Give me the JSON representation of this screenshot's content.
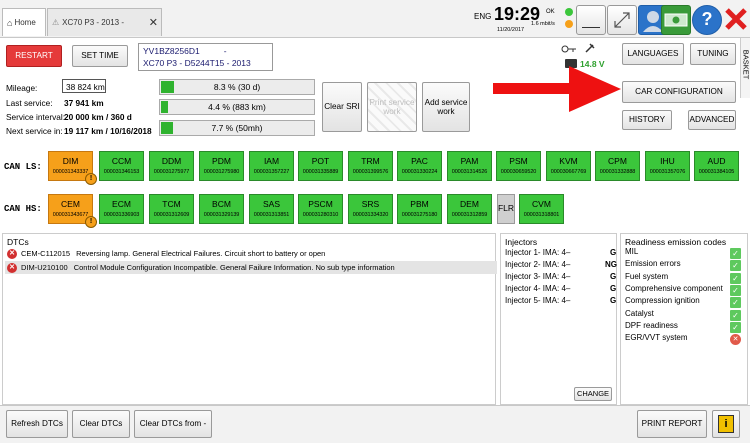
{
  "tabs": [
    {
      "label": "Home",
      "close": "✕"
    },
    {
      "label": "XC70 P3 - 2013 -",
      "close": "✕"
    }
  ],
  "status": {
    "lang": "ENG",
    "time": "19:29",
    "date": "11/20/2017",
    "speed": "1.6 mbit/s",
    "ok_label": "OK"
  },
  "toolbar": {
    "restart": "RESTART",
    "set_time": "SET TIME",
    "vin": "YV1BZ8256D1",
    "vin_suffix": "-",
    "model": "XC70 P3 - D5244T15 - 2013",
    "voltage": "14.8 V",
    "languages": "LANGUAGES",
    "tuning": "TUNING",
    "basket": "BASKET",
    "car_configuration": "CAR CONFIGURATION",
    "history": "HISTORY",
    "advanced": "ADVANCED"
  },
  "service": {
    "mileage_label": "Mileage:",
    "mileage_value": "38 824 km",
    "last_service_label": "Last service:",
    "last_service_value": "37 941 km",
    "interval_label": "Service interval:",
    "interval_value": "20 000 km / 360 d",
    "next_label": "Next service in:",
    "next_value": "19 117 km / 10/16/2018",
    "bars": [
      {
        "text": "8.3 % (30 d)",
        "fraction": 0.083
      },
      {
        "text": "4.4 % (883 km)",
        "fraction": 0.044
      },
      {
        "text": "7.7 % (50mh)",
        "fraction": 0.077
      }
    ],
    "clear_sri": "Clear SRI",
    "print_service": "Print service work",
    "add_service": "Add service work"
  },
  "can_ls": {
    "label": "CAN LS:",
    "ecus": [
      {
        "name": "DIM",
        "serial": "000031343337",
        "status": "warn"
      },
      {
        "name": "CCM",
        "serial": "000031346153",
        "status": "ok"
      },
      {
        "name": "DDM",
        "serial": "000031275977",
        "status": "ok"
      },
      {
        "name": "PDM",
        "serial": "000031275980",
        "status": "ok"
      },
      {
        "name": "IAM",
        "serial": "000031357227",
        "status": "ok"
      },
      {
        "name": "POT",
        "serial": "000031335889",
        "status": "ok"
      },
      {
        "name": "TRM",
        "serial": "000031399576",
        "status": "ok"
      },
      {
        "name": "PAC",
        "serial": "000031330224",
        "status": "ok"
      },
      {
        "name": "PAM",
        "serial": "000031314526",
        "status": "ok"
      },
      {
        "name": "PSM",
        "serial": "000030659520",
        "status": "ok"
      },
      {
        "name": "KVM",
        "serial": "000030667769",
        "status": "ok"
      },
      {
        "name": "CPM",
        "serial": "000031332888",
        "status": "ok"
      },
      {
        "name": "IHU",
        "serial": "000031357076",
        "status": "ok"
      },
      {
        "name": "AUD",
        "serial": "000031384105",
        "status": "ok"
      }
    ]
  },
  "can_hs": {
    "label": "CAN HS:",
    "ecus": [
      {
        "name": "CEM",
        "serial": "000031343677",
        "status": "warn"
      },
      {
        "name": "ECM",
        "serial": "000031336903",
        "status": "ok"
      },
      {
        "name": "TCM",
        "serial": "000031312609",
        "status": "ok"
      },
      {
        "name": "BCM",
        "serial": "000031329139",
        "status": "ok"
      },
      {
        "name": "SAS",
        "serial": "000031313851",
        "status": "ok"
      },
      {
        "name": "PSCM",
        "serial": "000031280310",
        "status": "ok"
      },
      {
        "name": "SRS",
        "serial": "000031334320",
        "status": "ok"
      },
      {
        "name": "PBM",
        "serial": "000031275180",
        "status": "ok"
      },
      {
        "name": "DEM",
        "serial": "000031312859",
        "status": "ok"
      },
      {
        "name": "FLR",
        "serial": "",
        "status": "gray"
      },
      {
        "name": "CVM",
        "serial": "000031318801",
        "status": "ok"
      }
    ]
  },
  "dtcs": {
    "title": "DTCs",
    "rows": [
      {
        "code": "CEM-C112015",
        "text": "Reversing lamp.  General Electrical Failures.  Circuit short to battery or open"
      },
      {
        "code": "DIM-U210100",
        "text": "Control Module Configuration Incompatible.  General Failure Information.  No sub type information"
      }
    ]
  },
  "injectors": {
    "title": "Injectors",
    "rows": [
      "Injector 1- IMA: 4–",
      "Injector 2- IMA: 4–",
      "Injector 3- IMA: 4–",
      "Injector 4- IMA: 4–",
      "Injector 5- IMA: 4–"
    ],
    "suffixes": [
      "G",
      "NG",
      "G",
      "G",
      "G"
    ],
    "change": "CHANGE"
  },
  "readiness": {
    "title": "Readiness emission codes",
    "rows": [
      {
        "label": "MIL",
        "ok": true
      },
      {
        "label": "Emission errors",
        "ok": true
      },
      {
        "label": "Fuel system",
        "ok": true
      },
      {
        "label": "Comprehensive component",
        "ok": true
      },
      {
        "label": "Compression ignition",
        "ok": true
      },
      {
        "label": "Catalyst",
        "ok": true
      },
      {
        "label": "DPF readiness",
        "ok": true
      },
      {
        "label": "EGR/VVT system",
        "ok": false
      }
    ]
  },
  "bottom": {
    "refresh": "Refresh DTCs",
    "clear": "Clear DTCs",
    "clear_from": "Clear DTCs from -",
    "print_report": "PRINT REPORT"
  }
}
